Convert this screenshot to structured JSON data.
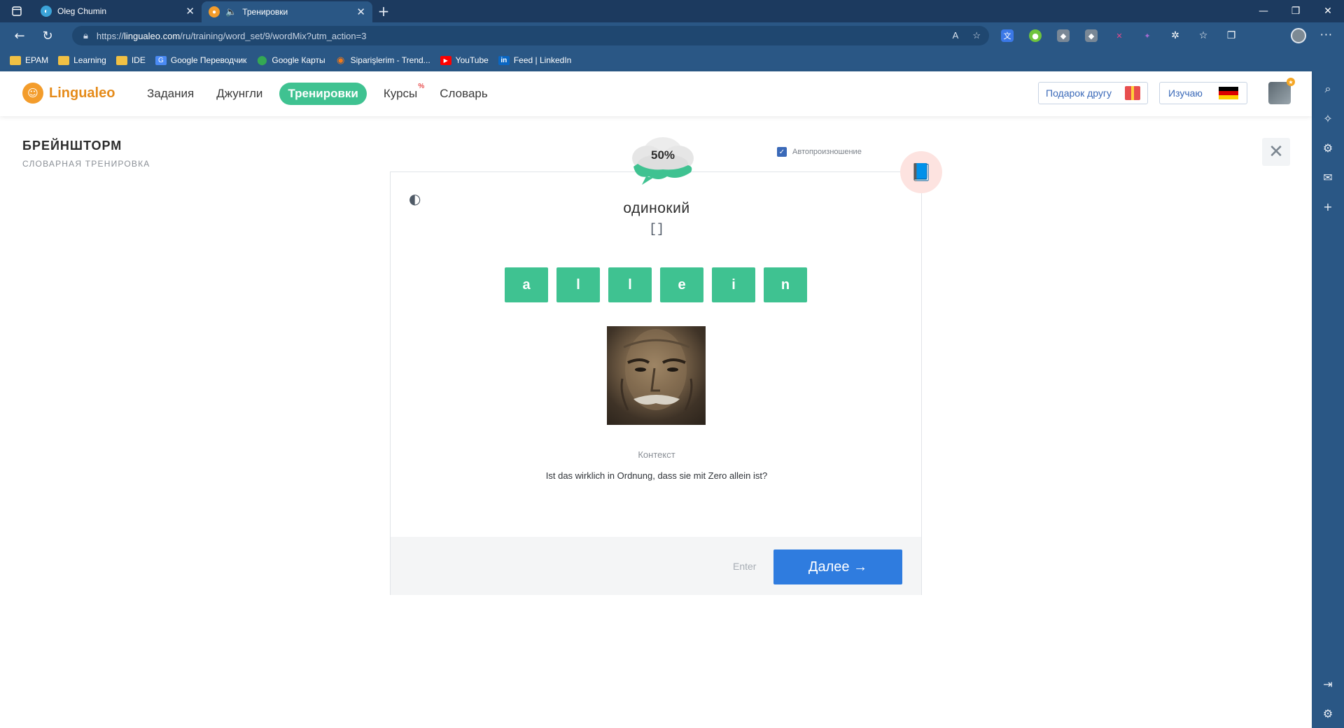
{
  "browser": {
    "tabs": [
      {
        "title": "Oleg Chumin",
        "active": false
      },
      {
        "title": "Тренировки",
        "active": true
      }
    ],
    "url_prefix": "https://",
    "url_host": "lingualeo.com",
    "url_path": "/ru/training/word_set/9/wordMix?utm_action=3",
    "bookmarks": [
      "EPAM",
      "Learning",
      "IDE",
      "Google Переводчик",
      "Google Карты",
      "Siparişlerim - Trend...",
      "YouTube",
      "Feed | LinkedIn"
    ]
  },
  "header": {
    "brand": "Lingualeo",
    "nav": [
      "Задания",
      "Джунгли",
      "Тренировки",
      "Курсы",
      "Словарь"
    ],
    "courses_badge": "%",
    "gift_label": "Подарок другу",
    "learning_label": "Изучаю"
  },
  "training": {
    "title": "БРЕЙНШТОРМ",
    "subtitle": "СЛОВАРНАЯ ТРЕНИРОВКА",
    "autoplay_label": "Автопроизношение",
    "autoplay_checked": true,
    "progress_label": "50%",
    "word": "одинокий",
    "answer_slot": "[]",
    "letters": [
      "a",
      "l",
      "l",
      "e",
      "i",
      "n"
    ],
    "context_label": "Контекст",
    "context_text": "Ist das wirklich in Ordnung, dass sie mit Zero allein ist?",
    "enter_hint": "Enter",
    "next_label": "Далее →"
  },
  "colors": {
    "accent_green": "#3fc291",
    "primary_blue": "#2f7cdf",
    "brand_orange": "#e58b1a",
    "chrome_blue": "#2a5785"
  }
}
